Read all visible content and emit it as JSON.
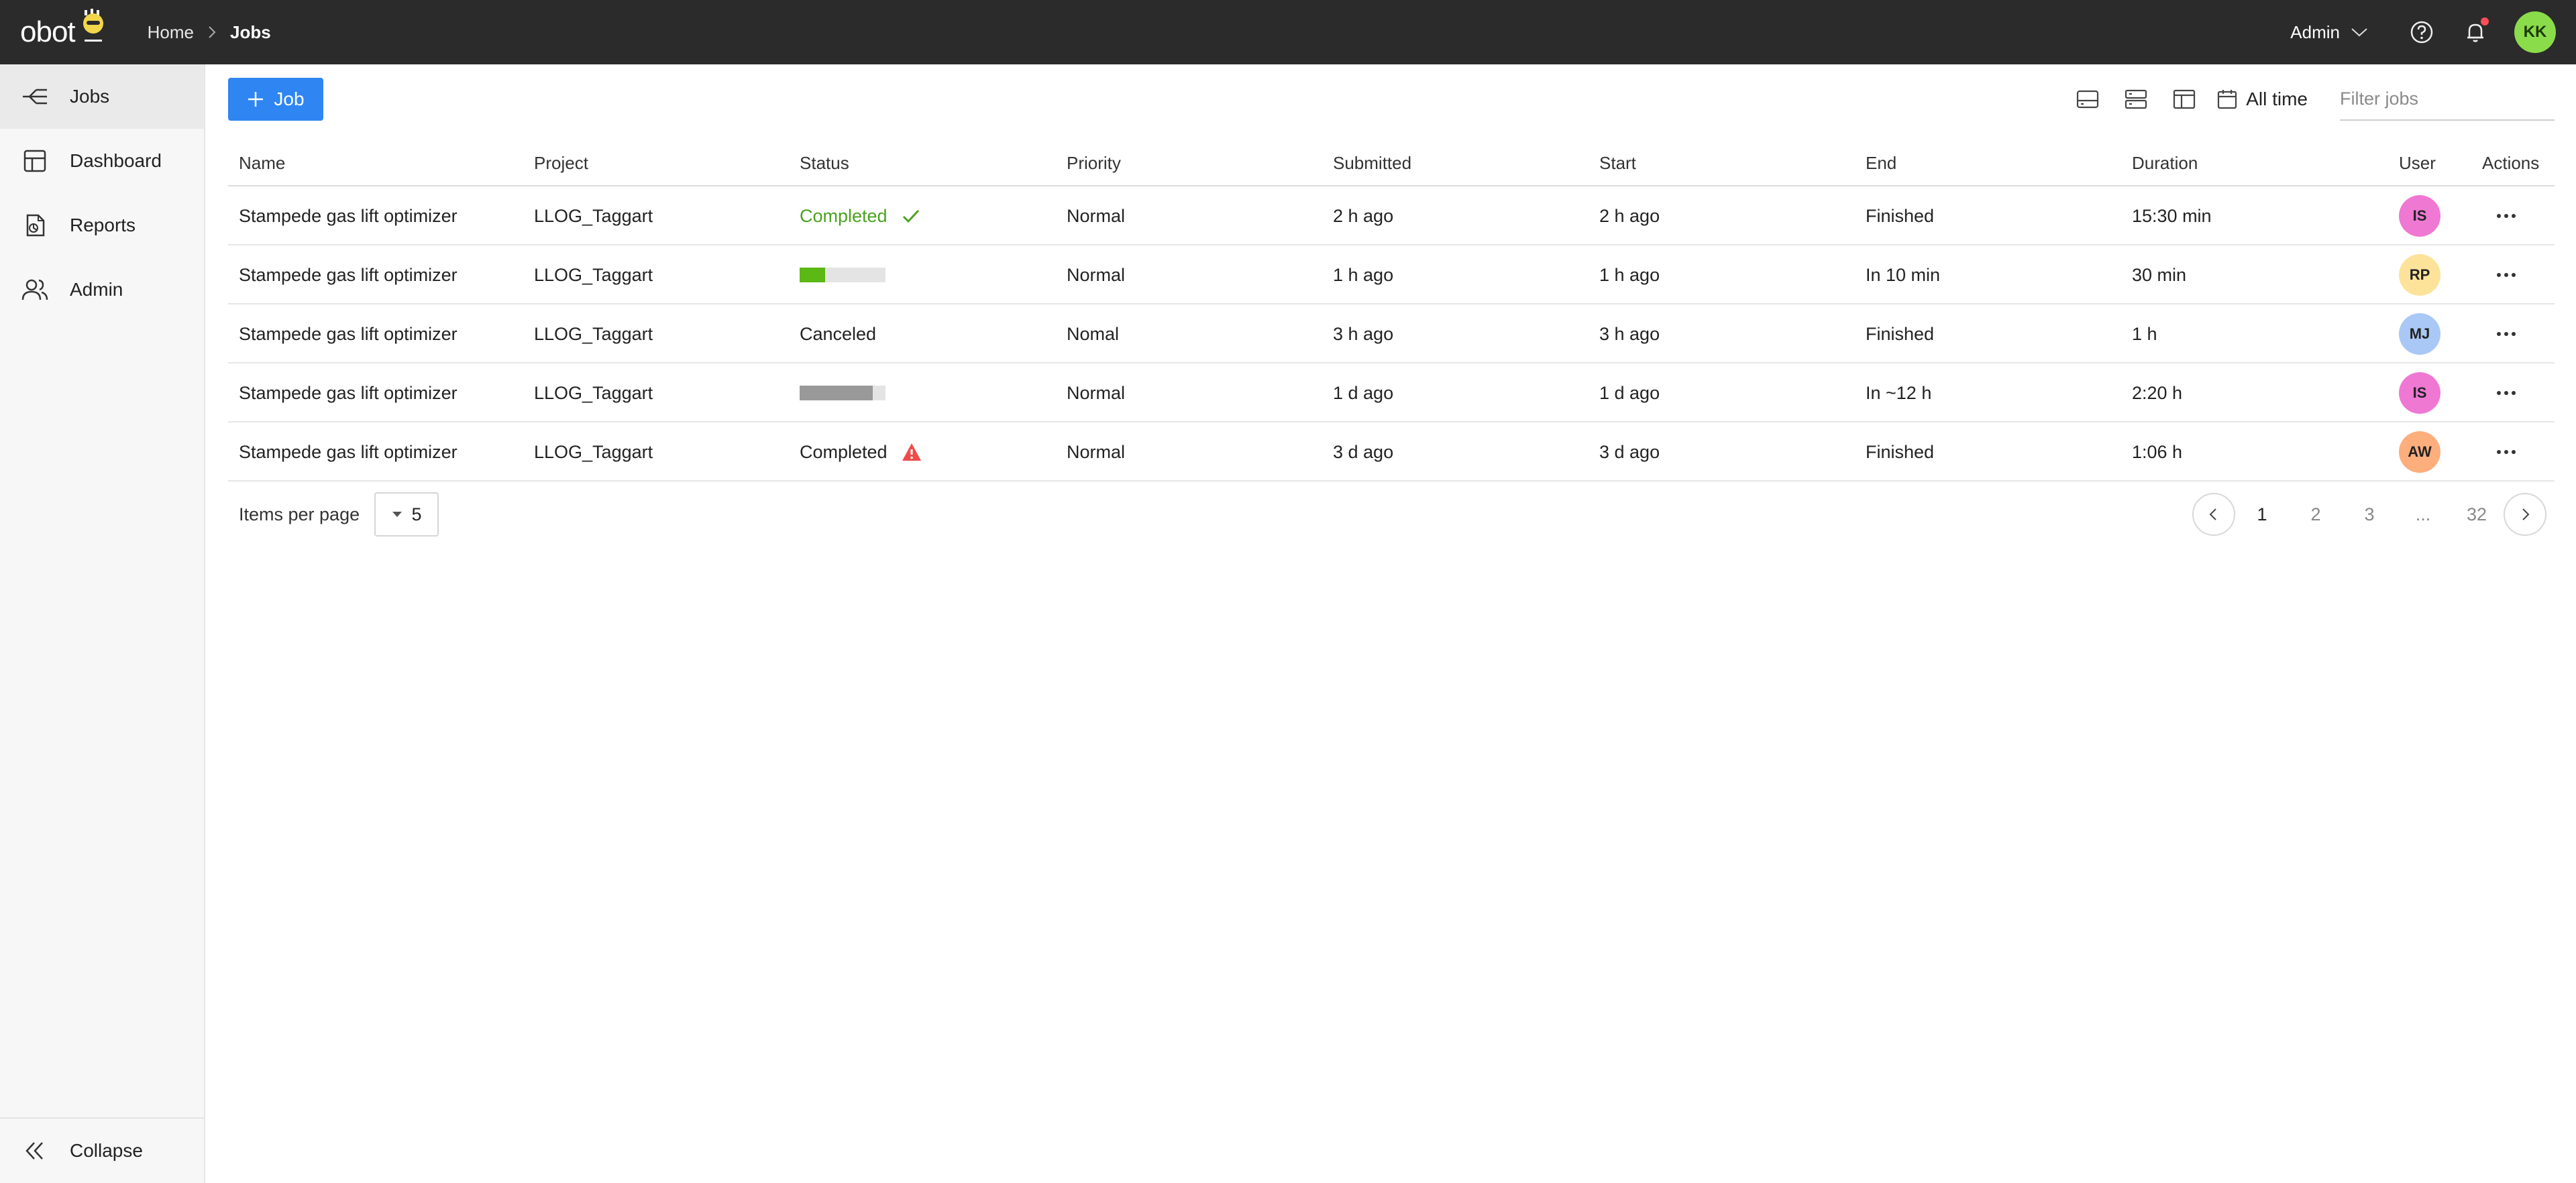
{
  "app": {
    "logo_text": "obot"
  },
  "breadcrumb": {
    "home": "Home",
    "current": "Jobs"
  },
  "topbar": {
    "admin_label": "Admin",
    "user_initials": "KK",
    "user_color": "#8bdc4a",
    "notification_dot_color": "#ff4d5a"
  },
  "sidebar": {
    "items": [
      {
        "label": "Jobs",
        "icon": "jobs-icon",
        "active": true
      },
      {
        "label": "Dashboard",
        "icon": "dashboard-icon"
      },
      {
        "label": "Reports",
        "icon": "reports-icon"
      },
      {
        "label": "Admin",
        "icon": "users-icon"
      }
    ],
    "collapse_label": "Collapse"
  },
  "toolbar": {
    "add_job_label": "Job",
    "time_filter_label": "All time",
    "filter_placeholder": "Filter jobs",
    "view_icons": [
      "view-compact-icon",
      "view-list-icon",
      "view-columns-icon"
    ],
    "accent_color": "#2f86f2"
  },
  "table": {
    "columns": [
      "Name",
      "Project",
      "Status",
      "Priority",
      "Submitted",
      "Start",
      "End",
      "Duration",
      "User",
      "Actions"
    ],
    "rows": [
      {
        "name": "Stampede gas lift optimizer",
        "project": "LLOG_Taggart",
        "status": {
          "kind": "text",
          "text": "Completed",
          "color": "#4aa21f",
          "icon": "check-icon"
        },
        "priority": "Normal",
        "submitted": "2 h ago",
        "start": "2 h ago",
        "end": "Finished",
        "duration": "15:30 min",
        "user": {
          "initials": "IS",
          "color": "#ef78d3"
        }
      },
      {
        "name": "Stampede gas lift optimizer",
        "project": "LLOG_Taggart",
        "status": {
          "kind": "progress",
          "fraction": 0.3,
          "color": "#5cb814"
        },
        "priority": "Normal",
        "submitted": "1 h ago",
        "start": "1 h ago",
        "end": "In 10 min",
        "duration": "30 min",
        "user": {
          "initials": "RP",
          "color": "#fde39a"
        }
      },
      {
        "name": "Stampede gas lift optimizer",
        "project": "LLOG_Taggart",
        "status": {
          "kind": "text",
          "text": "Canceled",
          "color": "#222222"
        },
        "priority": "Nomal",
        "submitted": "3 h ago",
        "start": "3 h ago",
        "end": "Finished",
        "duration": "1 h",
        "user": {
          "initials": "MJ",
          "color": "#a9c8f5"
        }
      },
      {
        "name": "Stampede gas lift optimizer",
        "project": "LLOG_Taggart",
        "status": {
          "kind": "progress",
          "fraction": 0.85,
          "color": "#999999"
        },
        "priority": "Normal",
        "submitted": "1 d ago",
        "start": "1 d ago",
        "end": "In ~12 h",
        "duration": "2:20 h",
        "user": {
          "initials": "IS",
          "color": "#ef78d3"
        }
      },
      {
        "name": "Stampede gas lift optimizer",
        "project": "LLOG_Taggart",
        "status": {
          "kind": "text",
          "text": "Completed",
          "color": "#222222",
          "icon": "warning-icon"
        },
        "priority": "Normal",
        "submitted": "3 d ago",
        "start": "3 d ago",
        "end": "Finished",
        "duration": "1:06 h",
        "user": {
          "initials": "AW",
          "color": "#fcae7c"
        }
      }
    ]
  },
  "pagination": {
    "items_per_page_label": "Items per page",
    "items_per_page_value": "5",
    "pages": [
      "1",
      "2",
      "3",
      "...",
      "32"
    ],
    "current_page": "1"
  }
}
